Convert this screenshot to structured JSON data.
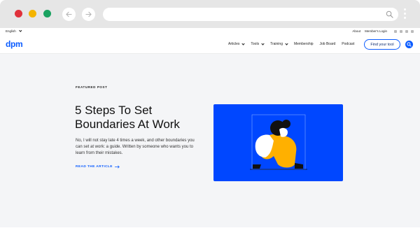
{
  "colors": {
    "accent": "#0b5cff",
    "hero_bg": "#0047ff",
    "close": "#e0313b",
    "minimize": "#f4b400",
    "maximize": "#1aa260"
  },
  "browser": {
    "back_icon": "arrow-left-icon",
    "forward_icon": "arrow-right-icon",
    "search_icon": "search-icon",
    "menu_icon": "kebab-menu-icon"
  },
  "topbar": {
    "language": "English",
    "about": "About",
    "members_login": "Member's Login",
    "social_icons": [
      "x-icon",
      "facebook-icon",
      "youtube-icon",
      "linkedin-icon"
    ]
  },
  "header": {
    "logo": "dpm",
    "menu": [
      {
        "label": "Articles",
        "dropdown": true
      },
      {
        "label": "Tools",
        "dropdown": true
      },
      {
        "label": "Training",
        "dropdown": true
      },
      {
        "label": "Membership",
        "dropdown": false
      },
      {
        "label": "Job Board",
        "dropdown": false
      },
      {
        "label": "Podcast",
        "dropdown": false
      }
    ],
    "cta": "Find your tool",
    "search_icon": "search-icon"
  },
  "featured": {
    "label": "FEATURED POST",
    "title_line1": "5 Steps To Set",
    "title_line2": "Boundaries At Work",
    "excerpt": "No, I will not stay late 4 times a week, and other boundaries you can set at work: a guide. Written by someone who wants you to learn from their mistakes.",
    "read_more": "READ THE ARTICLE",
    "read_more_icon": "arrow-right-icon"
  }
}
